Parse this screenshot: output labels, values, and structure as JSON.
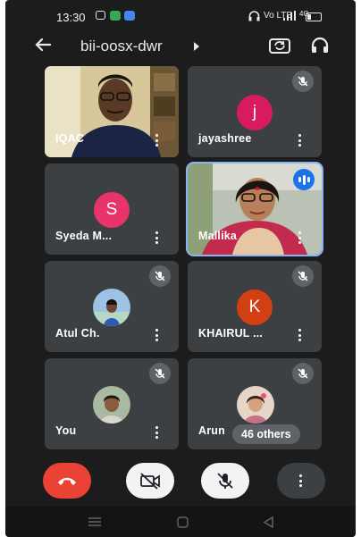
{
  "status_bar": {
    "time": "13:30",
    "network_text": "Vo LTE",
    "signal_text": "4G"
  },
  "app_bar": {
    "meeting_code": "bii-oosx-dwr"
  },
  "tiles": [
    {
      "name": "IQAC"
    },
    {
      "name": "jayashree",
      "initial": "j",
      "avatar_color": "#d81b60"
    },
    {
      "name": "Syeda M...",
      "initial": "S",
      "avatar_color": "#e8336b"
    },
    {
      "name": "Mallika"
    },
    {
      "name": "Atul Ch."
    },
    {
      "name": "KHAIRUL ...",
      "initial": "K",
      "avatar_color": "#d23f13"
    },
    {
      "name": "You"
    },
    {
      "name": "Arun"
    }
  ],
  "others_badge": "46 others",
  "colors": {
    "background": "#1c1c1d",
    "tile": "#3c4043",
    "end_call": "#ea4335",
    "speaking_outline": "#8ab4f8"
  },
  "icons": {
    "back": "arrow-left-icon",
    "flip_camera": "flip-camera-icon",
    "audio_output": "headphones-icon",
    "mic_off": "mic-off-icon",
    "camera_off": "videocam-off-icon",
    "end_call": "call-end-icon",
    "more": "more-vert-icon"
  }
}
